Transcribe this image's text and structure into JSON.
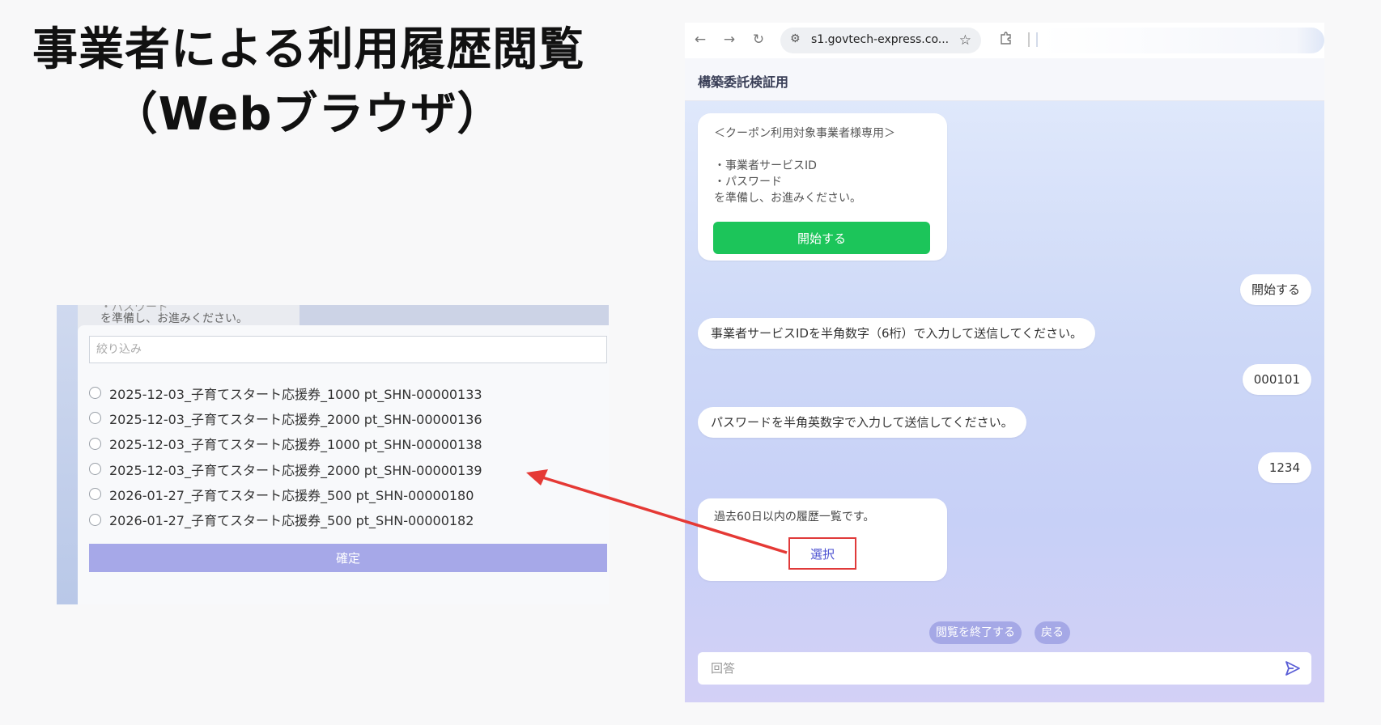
{
  "slide": {
    "title_line1": "事業者による利用履歴閲覧",
    "title_line2": "（Webブラウザ）"
  },
  "zoom_panel": {
    "behind_text_1": "・パスワード",
    "behind_text_2": "を準備し、お進みください。",
    "filter_placeholder": "絞り込み",
    "options": [
      "2025-12-03_子育てスタート応援券_1000 pt_SHN-00000133",
      "2025-12-03_子育てスタート応援券_2000 pt_SHN-00000136",
      "2025-12-03_子育てスタート応援券_1000 pt_SHN-00000138",
      "2025-12-03_子育てスタート応援券_2000 pt_SHN-00000139",
      "2026-01-27_子育てスタート応援券_500 pt_SHN-00000180",
      "2026-01-27_子育てスタート応援券_500 pt_SHN-00000182"
    ],
    "confirm_label": "確定"
  },
  "browser": {
    "url": "s1.govtech-express.co...",
    "icons": {
      "back": "arrow-left-icon",
      "forward": "arrow-right-icon",
      "reload": "reload-icon",
      "site": "site-settings-icon",
      "bookmark": "star-icon",
      "extensions": "puzzle-icon",
      "send": "send-icon"
    }
  },
  "app": {
    "title": "構築委託検証用",
    "intro_card": {
      "heading": "＜クーポン利用対象事業者様専用＞",
      "item1": "・事業者サービスID",
      "item2": "・パスワード",
      "note": "を準備し、お進みください。",
      "start_button": "開始する"
    },
    "messages": {
      "user_start": "開始する",
      "bot_id_prompt": "事業者サービスIDを半角数字（6桁）で入力して送信してください。",
      "user_id": "000101",
      "bot_pw_prompt": "パスワードを半角英数字で入力して送信してください。",
      "user_pw": "1234"
    },
    "history_card": {
      "text": "過去60日以内の履歴一覧です。",
      "select_button": "選択"
    },
    "chips": {
      "end_browsing": "閲覧を終了する",
      "back": "戻る"
    },
    "answer_placeholder": "回答"
  },
  "colors": {
    "start_button": "#1cc55a",
    "highlight_border": "#e03a3a",
    "arrow": "#e53935",
    "confirm_button": "#a6a8e8",
    "chip": "#a5a8e6"
  }
}
